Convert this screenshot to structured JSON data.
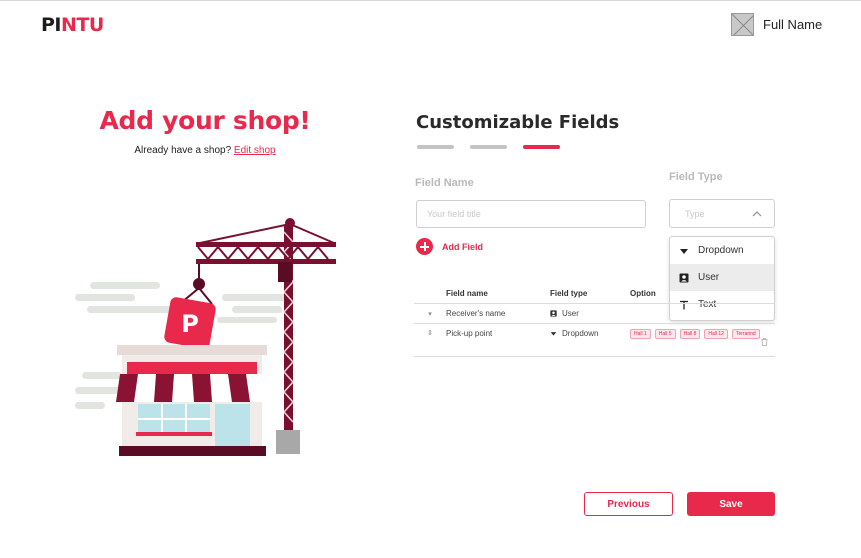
{
  "header": {
    "logo_dark": "PI",
    "logo_red": "NTU",
    "user_name": "Full Name"
  },
  "hero": {
    "title": "Add your shop!",
    "subtitle": "Already have a shop?",
    "edit_link": "Edit shop"
  },
  "form": {
    "title": "Customizable Fields",
    "steps": 3,
    "active_step": 3,
    "field_name_label": "Field Name",
    "field_name_placeholder": "Your field title",
    "field_type_label": "Field Type",
    "field_type_placeholder": "Type",
    "add_field_label": "Add Field",
    "dropdown_options": [
      {
        "label": "Dropdown",
        "icon": "caret-down-icon"
      },
      {
        "label": "User",
        "icon": "user-card-icon",
        "selected": true
      },
      {
        "label": "Text",
        "icon": "text-icon"
      }
    ]
  },
  "table": {
    "headers": [
      "Field name",
      "Field type",
      "Option"
    ],
    "rows": [
      {
        "name": "Receiver's name",
        "type": "User",
        "type_icon": "user-card-icon",
        "options": []
      },
      {
        "name": "Pick-up point",
        "type": "Dropdown",
        "type_icon": "caret-down-icon",
        "options": [
          "Hall 1",
          "Hall 5",
          "Hall 8",
          "Hall 12",
          "Terrarind"
        ]
      }
    ]
  },
  "actions": {
    "previous": "Previous",
    "save": "Save"
  },
  "colors": {
    "brand": "#e8294c",
    "dark": "#1c1c1c"
  }
}
